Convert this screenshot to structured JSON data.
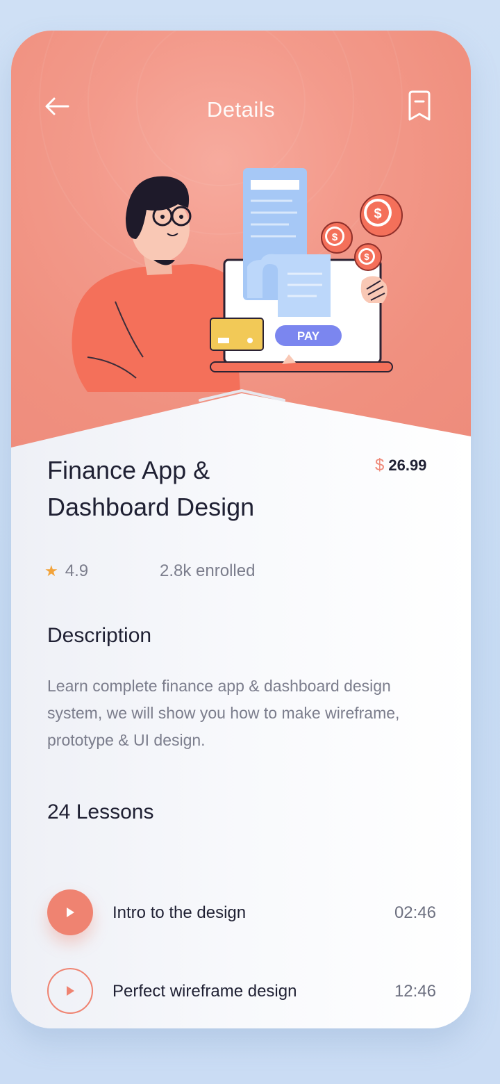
{
  "header": {
    "title": "Details",
    "back_icon": "arrow-left-icon",
    "bookmark_icon": "bookmark-icon"
  },
  "illustration": {
    "pay_label": "PAY",
    "coin_symbol": "$"
  },
  "course": {
    "title": "Finance App & Dashboard Design",
    "price_currency": "$",
    "price": "26.99",
    "rating": "4.9",
    "enrolled": "2.8k enrolled"
  },
  "description": {
    "heading": "Description",
    "text": "Learn complete finance app & dashboard design system, we will show you how to make wireframe, prototype & UI design."
  },
  "lessons": {
    "heading": "24 Lessons",
    "items": [
      {
        "name": "Intro to the design",
        "duration": "02:46",
        "style": "filled"
      },
      {
        "name": "Perfect wireframe design",
        "duration": "12:46",
        "style": "outline"
      }
    ]
  },
  "colors": {
    "accent": "#ef8371",
    "hero": "#f39a8b",
    "text_dark": "#1f2033",
    "text_muted": "#7b7d8c",
    "star": "#f2a33a",
    "pay_button": "#7b86ef"
  }
}
